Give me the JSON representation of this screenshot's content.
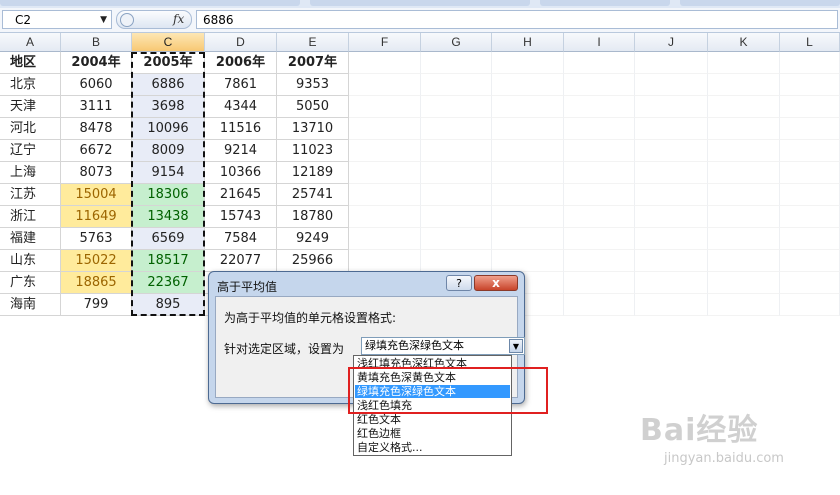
{
  "name_box": "C2",
  "fx_label": "fx",
  "formula_value": "6886",
  "columns": [
    "A",
    "B",
    "C",
    "D",
    "E",
    "F",
    "G",
    "H",
    "I",
    "J",
    "K",
    "L"
  ],
  "table": {
    "headers": [
      "地区",
      "2004年",
      "2005年",
      "2006年",
      "2007年"
    ],
    "rows": [
      [
        "北京",
        "6060",
        "6886",
        "7861",
        "9353"
      ],
      [
        "天津",
        "3111",
        "3698",
        "4344",
        "5050"
      ],
      [
        "河北",
        "8478",
        "10096",
        "11516",
        "13710"
      ],
      [
        "辽宁",
        "6672",
        "8009",
        "9214",
        "11023"
      ],
      [
        "上海",
        "8073",
        "9154",
        "10366",
        "12189"
      ],
      [
        "江苏",
        "15004",
        "18306",
        "21645",
        "25741"
      ],
      [
        "浙江",
        "11649",
        "13438",
        "15743",
        "18780"
      ],
      [
        "福建",
        "5763",
        "6569",
        "7584",
        "9249"
      ],
      [
        "山东",
        "15022",
        "18517",
        "22077",
        "25966"
      ],
      [
        "广东",
        "18865",
        "22367",
        "",
        ""
      ],
      [
        "海南",
        "799",
        "895",
        "",
        ""
      ]
    ]
  },
  "dialog": {
    "title": "高于平均值",
    "help": "?",
    "close": "x",
    "description": "为高于平均值的单元格设置格式:",
    "label": "针对选定区域，设置为",
    "combo_value": "绿填充色深绿色文本",
    "options": [
      "浅红填充色深红色文本",
      "黄填充色深黄色文本",
      "绿填充色深绿色文本",
      "浅红色填充",
      "红色文本",
      "红色边框",
      "自定义格式..."
    ],
    "selected_index": 2
  },
  "watermark": {
    "logo": "Bai经验",
    "url": "jingyan.baidu.com"
  },
  "colors": {
    "highlight_yellow": "#ffeb9c",
    "highlight_green": "#c6efce",
    "selection": "#3399ff",
    "annotation_red": "#e02020"
  }
}
